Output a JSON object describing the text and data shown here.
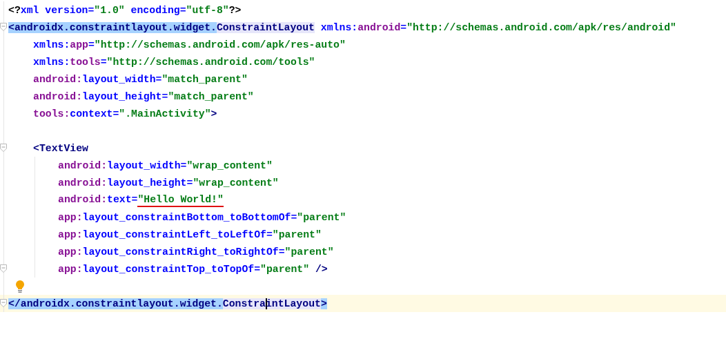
{
  "editor": {
    "lines": [
      {
        "kind": "code",
        "tokens": [
          {
            "text": "<?",
            "kind": "plain"
          },
          {
            "text": "xml version=",
            "kind": "attr"
          },
          {
            "text": "\"1.0\"",
            "kind": "value"
          },
          {
            "text": " encoding=",
            "kind": "attr"
          },
          {
            "text": "\"utf-8\"",
            "kind": "value"
          },
          {
            "text": "?>",
            "kind": "plain"
          }
        ]
      },
      {
        "kind": "code",
        "fold": true,
        "tokens": [
          {
            "text": "<androidx.constraintlayout.widget.",
            "kind": "tag",
            "matched": true
          },
          {
            "text": "ConstraintLayout",
            "kind": "tag",
            "occurrence": true
          },
          {
            "text": " xmlns:",
            "kind": "attr"
          },
          {
            "text": "android",
            "kind": "ns"
          },
          {
            "text": "=",
            "kind": "attr"
          },
          {
            "text": "\"http://schemas.android.com/apk/res/android\"",
            "kind": "value"
          }
        ],
        "children": [
          {
            "kind": "code",
            "tokens": [
              {
                "text": "xmlns:",
                "kind": "attr"
              },
              {
                "text": "app",
                "kind": "ns"
              },
              {
                "text": "=",
                "kind": "attr"
              },
              {
                "text": "\"http://schemas.android.com/apk/res-auto\"",
                "kind": "value"
              }
            ]
          },
          {
            "kind": "code",
            "tokens": [
              {
                "text": "xmlns:",
                "kind": "attr"
              },
              {
                "text": "tools",
                "kind": "ns"
              },
              {
                "text": "=",
                "kind": "attr"
              },
              {
                "text": "\"http://schemas.android.com/tools\"",
                "kind": "value"
              }
            ]
          },
          {
            "kind": "code",
            "tokens": [
              {
                "text": "android:",
                "kind": "ns"
              },
              {
                "text": "layout_width=",
                "kind": "attr"
              },
              {
                "text": "\"match_parent\"",
                "kind": "value"
              }
            ]
          },
          {
            "kind": "code",
            "tokens": [
              {
                "text": "android:",
                "kind": "ns"
              },
              {
                "text": "layout_height=",
                "kind": "attr"
              },
              {
                "text": "\"match_parent\"",
                "kind": "value"
              }
            ]
          },
          {
            "kind": "code",
            "tokens": [
              {
                "text": "tools:",
                "kind": "ns"
              },
              {
                "text": "context=",
                "kind": "attr"
              },
              {
                "text": "\".MainActivity\"",
                "kind": "value"
              },
              {
                "text": ">",
                "kind": "tag"
              }
            ]
          },
          {
            "kind": "blank"
          },
          {
            "kind": "code",
            "fold": true,
            "tokens": [
              {
                "text": "<TextView",
                "kind": "tag"
              }
            ],
            "children": [
              {
                "kind": "code",
                "tokens": [
                  {
                    "text": "android:",
                    "kind": "ns"
                  },
                  {
                    "text": "layout_width=",
                    "kind": "attr"
                  },
                  {
                    "text": "\"wrap_content\"",
                    "kind": "value"
                  }
                ]
              },
              {
                "kind": "code",
                "tokens": [
                  {
                    "text": "android:",
                    "kind": "ns"
                  },
                  {
                    "text": "layout_height=",
                    "kind": "attr"
                  },
                  {
                    "text": "\"wrap_content\"",
                    "kind": "value"
                  }
                ]
              },
              {
                "kind": "code",
                "tokens": [
                  {
                    "text": "android:",
                    "kind": "ns"
                  },
                  {
                    "text": "text=",
                    "kind": "attr"
                  },
                  {
                    "text": "\"Hello World!\"",
                    "kind": "value",
                    "typo": true
                  }
                ]
              },
              {
                "kind": "code",
                "tokens": [
                  {
                    "text": "app:",
                    "kind": "ns"
                  },
                  {
                    "text": "layout_constraintBottom_toBottomOf=",
                    "kind": "attr"
                  },
                  {
                    "text": "\"parent\"",
                    "kind": "value"
                  }
                ]
              },
              {
                "kind": "code",
                "tokens": [
                  {
                    "text": "app:",
                    "kind": "ns"
                  },
                  {
                    "text": "layout_constraintLeft_toLeftOf=",
                    "kind": "attr"
                  },
                  {
                    "text": "\"parent\"",
                    "kind": "value"
                  }
                ]
              },
              {
                "kind": "code",
                "tokens": [
                  {
                    "text": "app:",
                    "kind": "ns"
                  },
                  {
                    "text": "layout_constraintRight_toRightOf=",
                    "kind": "attr"
                  },
                  {
                    "text": "\"parent\"",
                    "kind": "value"
                  }
                ]
              },
              {
                "kind": "code",
                "fold": true,
                "tokens": [
                  {
                    "text": "app:",
                    "kind": "ns"
                  },
                  {
                    "text": "layout_constraintTop_toTopOf=",
                    "kind": "attr"
                  },
                  {
                    "text": "\"parent\"",
                    "kind": "value"
                  },
                  {
                    "text": " />",
                    "kind": "tag"
                  }
                ]
              }
            ]
          }
        ]
      },
      {
        "kind": "blank",
        "intention": true
      },
      {
        "kind": "code",
        "fold": true,
        "current": true,
        "tokens": [
          {
            "text": "</androidx.constraintlayout.widget.",
            "kind": "tag",
            "matched": true
          },
          {
            "text": "Constra",
            "kind": "tag",
            "occurrence": true
          },
          {
            "text": "intLayout",
            "kind": "tag",
            "occurrence": true,
            "caret": true
          },
          {
            "text": ">",
            "kind": "tag",
            "matched": true
          }
        ]
      }
    ]
  }
}
